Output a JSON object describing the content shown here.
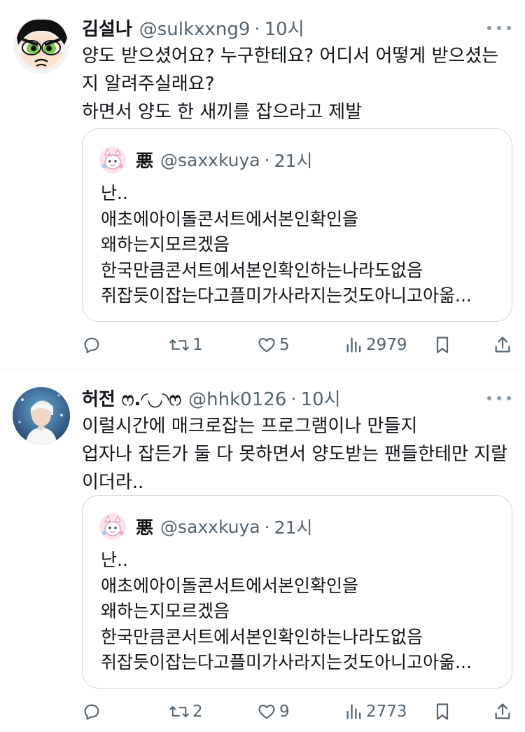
{
  "tweets": [
    {
      "name": "김설나",
      "handle": "@sulkxxng9",
      "dot": "·",
      "time": "10시",
      "avatar_icon": "powerpuff-buttercup-avatar",
      "body": [
        "양도 받으셨어요? 누구한테요? 어디서 어떻게 받으셨는",
        "지 알려주실래요?",
        "하면서 양도 한 새끼를 잡으라고 제발"
      ],
      "quote": {
        "name": "悪",
        "handle": "@saxxkuya",
        "dot": "·",
        "time": "21시",
        "body": [
          "난..",
          "애초에아이돌콘서트에서본인확인을",
          "왜하는지모르겠음",
          "한국만큼콘서트에서본인확인하는나라도없음",
          "쥐잡듯이잡는다고플미가사라지는것도아니고아옮..."
        ]
      },
      "actions": {
        "replies": "",
        "retweets": "1",
        "likes": "5",
        "views": "2979"
      }
    },
    {
      "name": "허전 ෆ.◜◡◝ෆ",
      "handle": "@hhk0126",
      "dot": "·",
      "time": "10시",
      "avatar_icon": "idol-stage-photo-avatar",
      "body": [
        "이럴시간에 매크로잡는 프로그램이나 만들지",
        "업자나 잡든가 둘 다 못하면서 양도받는 팬들한테만 지랄",
        "이더라.."
      ],
      "quote": {
        "name": "悪",
        "handle": "@saxxkuya",
        "dot": "·",
        "time": "21시",
        "body": [
          "난..",
          "애초에아이돌콘서트에서본인확인을",
          "왜하는지모르겠음",
          "한국만큼콘서트에서본인확인하는나라도없음",
          "쥐잡듯이잡는다고플미가사라지는것도아니고아옮..."
        ]
      },
      "actions": {
        "replies": "",
        "retweets": "2",
        "likes": "9",
        "views": "2773"
      }
    }
  ],
  "colors": {
    "text": "#0f1419",
    "secondary": "#536471",
    "border": "#cfd9de",
    "divider": "#eff3f4"
  }
}
